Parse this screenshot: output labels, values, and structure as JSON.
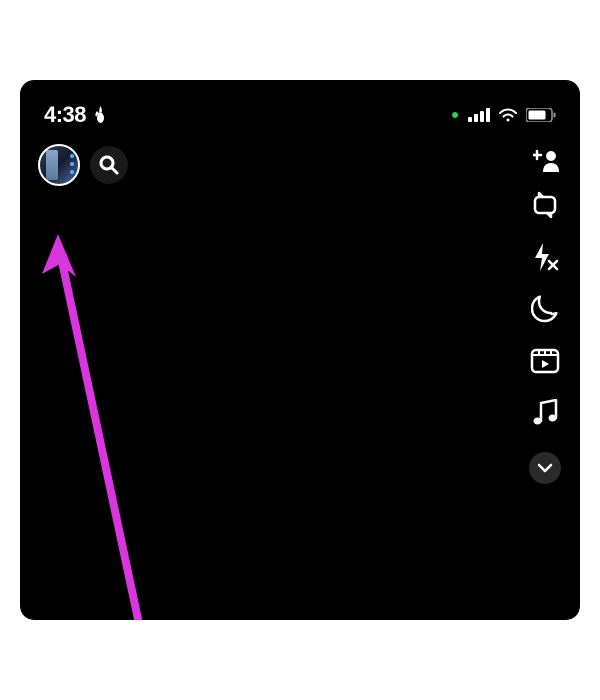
{
  "status_bar": {
    "time": "4:38",
    "streak_icon": "fire-icon",
    "privacy_indicator": "green-dot",
    "signal": "cellular-signal",
    "wifi": "wifi",
    "battery": "battery"
  },
  "top_controls": {
    "avatar": "profile-avatar",
    "search": "search",
    "add_friend": "add-friend"
  },
  "camera_tools": [
    {
      "name": "flip-camera-icon",
      "label": "flip-camera"
    },
    {
      "name": "flash-off-icon",
      "label": "flash-off"
    },
    {
      "name": "night-mode-icon",
      "label": "night-mode"
    },
    {
      "name": "video-clip-icon",
      "label": "video-clip"
    },
    {
      "name": "music-icon",
      "label": "music"
    }
  ],
  "expand": "expand-tools",
  "annotation": {
    "color": "#d936e0",
    "target": "profile-avatar"
  }
}
